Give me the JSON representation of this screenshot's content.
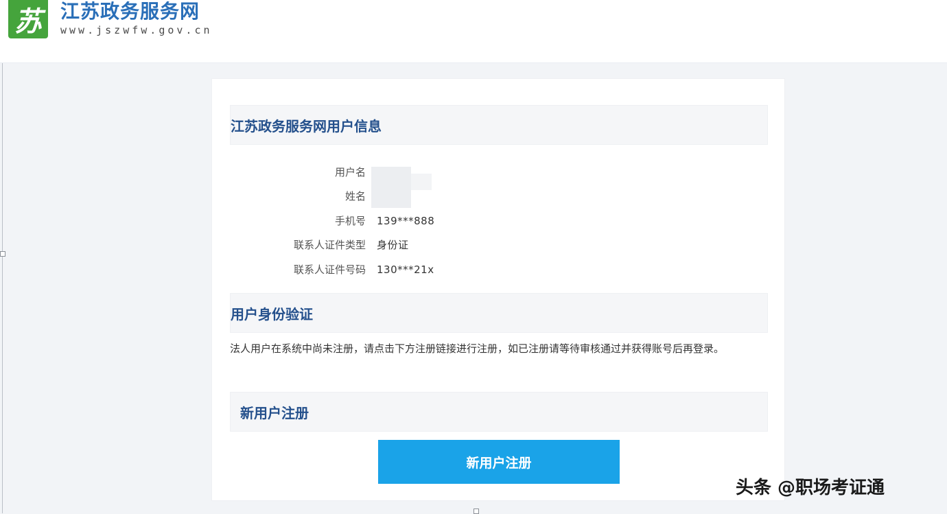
{
  "header": {
    "logo_char": "苏",
    "site_title": "江苏政务服务网",
    "site_url": "www.jszwfw.gov.cn"
  },
  "user_info": {
    "section_title": "江苏政务服务网用户信息",
    "rows": [
      {
        "label": "用户名",
        "value": ""
      },
      {
        "label": "姓名",
        "value": ""
      },
      {
        "label": "手机号",
        "value": "139***888"
      },
      {
        "label": "联系人证件类型",
        "value": "身份证"
      },
      {
        "label": "联系人证件号码",
        "value": "130***21x"
      }
    ],
    "colon": ":"
  },
  "identity": {
    "section_title": "用户身份验证",
    "notice": "法人用户在系统中尚未注册，请点击下方注册链接进行注册，如已注册请等待审核通过并获得账号后再登录。"
  },
  "register": {
    "section_title": "新用户注册",
    "button_label": "新用户注册"
  },
  "watermark": "头条 @职场考证通",
  "colors": {
    "brand_green": "#45a43c",
    "title_blue": "#2a6fb8",
    "section_blue": "#24508c",
    "button_blue": "#1aa3e8"
  }
}
